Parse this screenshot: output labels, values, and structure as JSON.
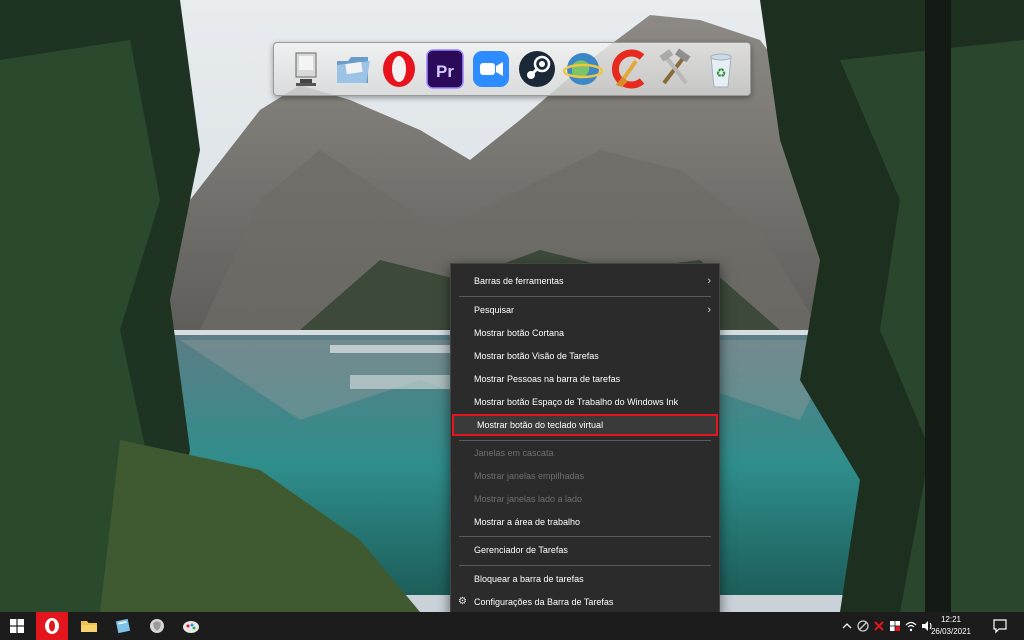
{
  "desktop": {
    "dock_icons": [
      {
        "name": "computer-icon"
      },
      {
        "name": "folder-icon"
      },
      {
        "name": "opera-icon",
        "color": "#e8141d"
      },
      {
        "name": "premiere-pro-icon",
        "label": "Pr",
        "color": "#2a0a59"
      },
      {
        "name": "zoom-icon",
        "color": "#2d8cff"
      },
      {
        "name": "steam-icon",
        "color": "#1b2838"
      },
      {
        "name": "globe-icon"
      },
      {
        "name": "ccleaner-icon",
        "color": "#e62b1e"
      },
      {
        "name": "tools-icon"
      },
      {
        "name": "recycle-bin-icon"
      }
    ]
  },
  "context_menu": {
    "items": [
      {
        "label": "Barras de ferramentas",
        "submenu": true
      },
      {
        "label": "Pesquisar",
        "submenu": true
      },
      {
        "label": "Mostrar botão Cortana"
      },
      {
        "label": "Mostrar botão Visão de Tarefas"
      },
      {
        "label": "Mostrar Pessoas na barra de tarefas"
      },
      {
        "label": "Mostrar botão Espaço de Trabalho do Windows Ink"
      },
      {
        "label": "Mostrar botão do teclado virtual",
        "highlighted": true
      },
      {
        "label": "Janelas em cascata",
        "disabled": true
      },
      {
        "label": "Mostrar janelas empilhadas",
        "disabled": true
      },
      {
        "label": "Mostrar janelas lado a lado",
        "disabled": true
      },
      {
        "label": "Mostrar a área de trabalho"
      },
      {
        "label": "Gerenciador de Tarefas"
      },
      {
        "label": "Bloquear a barra de tarefas"
      },
      {
        "label": "Configurações da Barra de Tarefas",
        "icon": "gear-icon"
      }
    ],
    "submenu_arrow": "›",
    "gear_glyph": "⚙"
  },
  "taskbar": {
    "clock": {
      "time": "12:21",
      "date": "26/03/2021"
    },
    "highlight_color": "#e2161c"
  }
}
